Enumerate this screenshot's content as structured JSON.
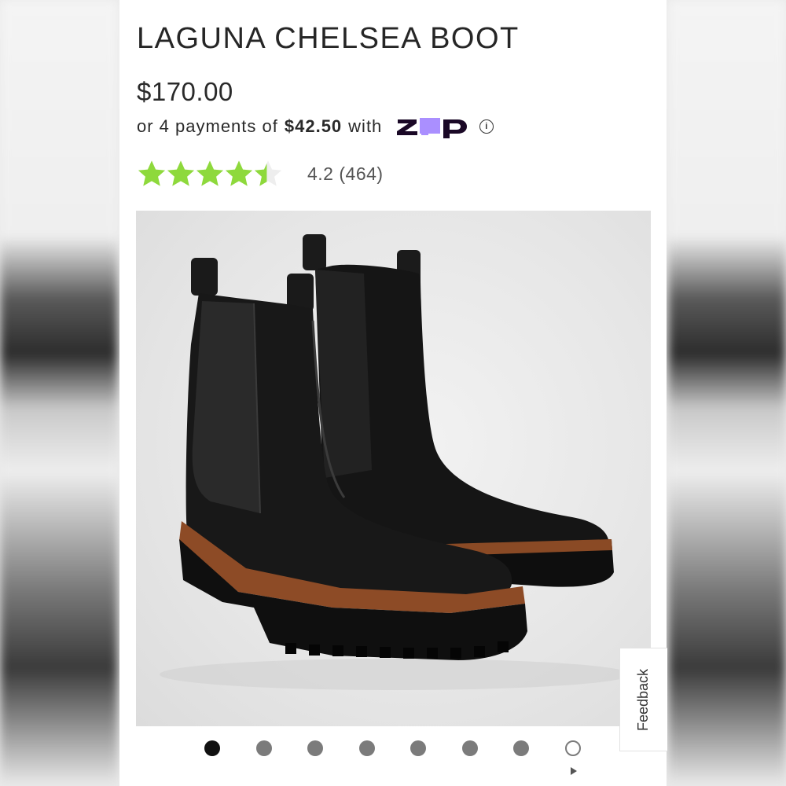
{
  "product": {
    "title": "LAGUNA CHELSEA BOOT",
    "price": "$170.00"
  },
  "payments": {
    "prefix": "or 4 payments of",
    "amount": "$42.50",
    "suffix": "with",
    "provider": "zip",
    "provider_colors": {
      "z": "#1a0826",
      "i": "#aa8fff",
      "p": "#1a0826"
    }
  },
  "rating": {
    "value": "4.2",
    "count": "(464)",
    "stars_filled": 4.2,
    "stars_total": 5,
    "star_color": "#8ed93c",
    "star_empty_color": "#eeeeee"
  },
  "gallery": {
    "image_subject": "black leather chelsea boots with tan welt",
    "dots_total": 8,
    "active_index": 0,
    "video_index": 7
  },
  "feedback": {
    "label": "Feedback"
  },
  "colors": {
    "text": "#262626",
    "dot": "#7b7b7b",
    "dot_active": "#111111"
  }
}
